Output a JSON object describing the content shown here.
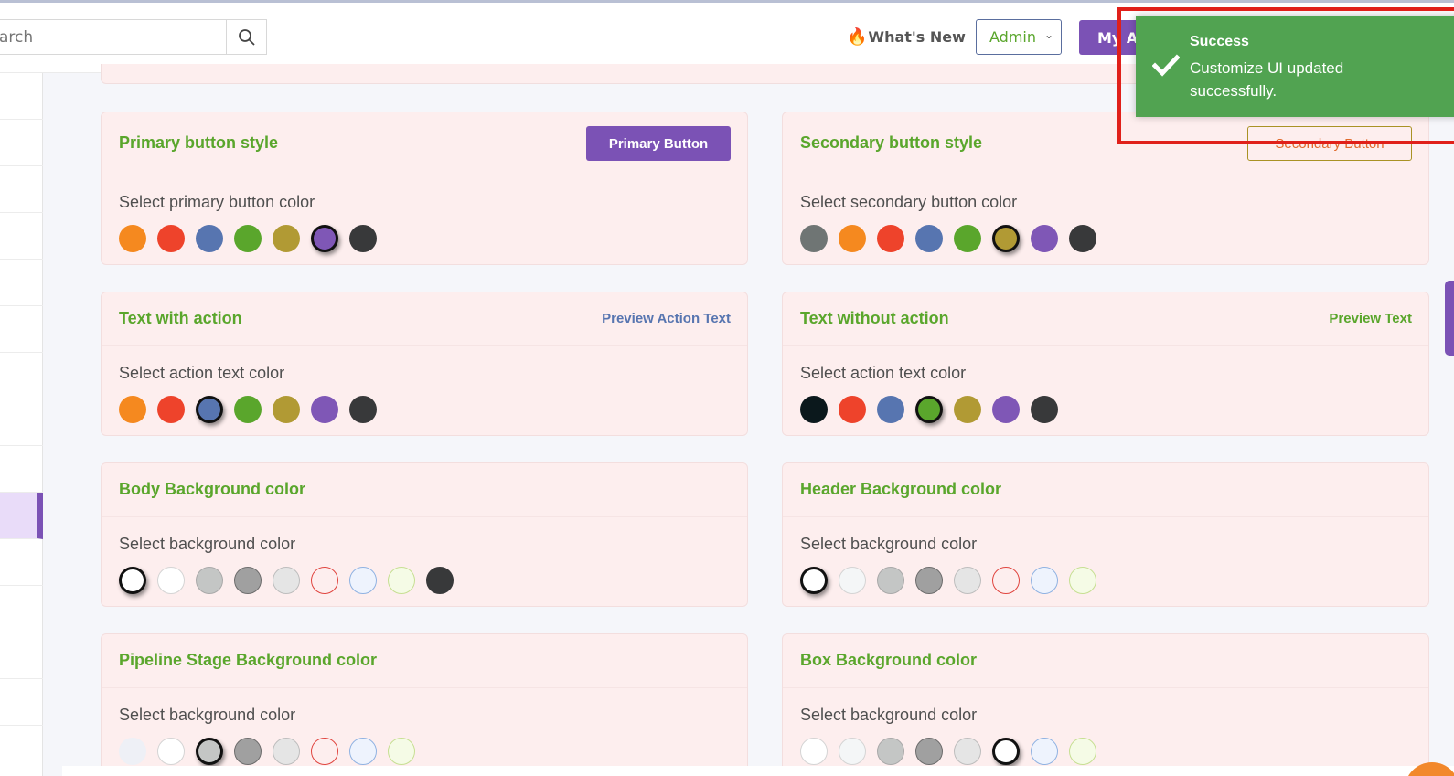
{
  "header": {
    "search_placeholder": "arch",
    "whats_new_label": "What's New",
    "whats_new_emoji": "🔥",
    "admin_select_value": "Admin",
    "my_agent_label": "My Ag"
  },
  "cards": {
    "primary": {
      "title": "Primary button style",
      "preview_label": "Primary Button",
      "select_label": "Select primary button color",
      "colors": [
        "#f5891f",
        "#ee432b",
        "#5775b0",
        "#5aa62c",
        "#b19a34",
        "#7f57b6",
        "#38393a"
      ],
      "selected_index": 5
    },
    "secondary": {
      "title": "Secondary button style",
      "preview_label": "Secondary Button",
      "select_label": "Select secondary button color",
      "colors": [
        "#6f7574",
        "#f5891f",
        "#ee432b",
        "#5775b0",
        "#5aa62c",
        "#b19a34",
        "#7f57b6",
        "#38393a"
      ],
      "selected_index": 5
    },
    "text_action": {
      "title": "Text with action",
      "preview_label": "Preview Action Text",
      "preview_color": "#5775b0",
      "select_label": "Select action text color",
      "colors": [
        "#f5891f",
        "#ee432b",
        "#5775b0",
        "#5aa62c",
        "#b19a34",
        "#7f57b6",
        "#38393a"
      ],
      "selected_index": 2
    },
    "text_no_action": {
      "title": "Text without action",
      "preview_label": "Preview Text",
      "preview_color": "#5aa62c",
      "select_label": "Select action text color",
      "colors": [
        "#0b181c",
        "#ee432b",
        "#5775b0",
        "#5aa62c",
        "#b19a34",
        "#7f57b6",
        "#38393a"
      ],
      "selected_index": 3
    },
    "body_bg": {
      "title": "Body Background color",
      "select_label": "Select background color",
      "colors": [
        "#ffffff",
        "#ffffff",
        "#c4c6c5",
        "#a0a0a0",
        "#e5e5e5",
        "#fdeeee",
        "#eef3fd",
        "#f5fbe6",
        "#38393a"
      ],
      "borders": [
        "#111",
        "#d4d4d4",
        "#a9a9a9",
        "#6c6c6c",
        "#bdbdbd",
        "#e0443e",
        "#8fb2e2",
        "#c6df92",
        "#38393a"
      ],
      "selected_index": 0
    },
    "header_bg": {
      "title": "Header Background color",
      "select_label": "Select background color",
      "colors": [
        "#ffffff",
        "#f4f6f7",
        "#c4c6c5",
        "#a0a0a0",
        "#e5e5e5",
        "#fdeeee",
        "#eef3fd",
        "#f5fbe6"
      ],
      "borders": [
        "#111",
        "#d4d4d4",
        "#a9a9a9",
        "#6c6c6c",
        "#bdbdbd",
        "#e0443e",
        "#8fb2e2",
        "#c6df92"
      ],
      "selected_index": 0
    },
    "pipeline_bg": {
      "title": "Pipeline Stage Background color",
      "select_label": "Select background color",
      "colors": [
        "#eef0f6",
        "#ffffff",
        "#c4c6c5",
        "#a0a0a0",
        "#e5e5e5",
        "#fdeeee",
        "#eef3fd",
        "#f5fbe6"
      ],
      "borders": [
        "#eef0f6",
        "#d4d4d4",
        "#111",
        "#6c6c6c",
        "#bdbdbd",
        "#e0443e",
        "#8fb2e2",
        "#c6df92"
      ],
      "selected_index": 2
    },
    "box_bg": {
      "title": "Box Background color",
      "select_label": "Select background color",
      "colors": [
        "#ffffff",
        "#f4f6f7",
        "#c4c6c5",
        "#a0a0a0",
        "#e5e5e5",
        "#ffffff",
        "#eef3fd",
        "#f5fbe6"
      ],
      "borders": [
        "#d4d4d4",
        "#d4d4d4",
        "#a9a9a9",
        "#6c6c6c",
        "#bdbdbd",
        "#111",
        "#8fb2e2",
        "#c6df92"
      ],
      "selected_index": 5
    }
  },
  "toast": {
    "title": "Success",
    "message": "Customize UI updated successfully."
  },
  "accent_colors": {
    "purple": "#7b52b5",
    "green": "#5aa62c",
    "toast_green": "#51a351",
    "highlight_red": "#e0201a"
  }
}
